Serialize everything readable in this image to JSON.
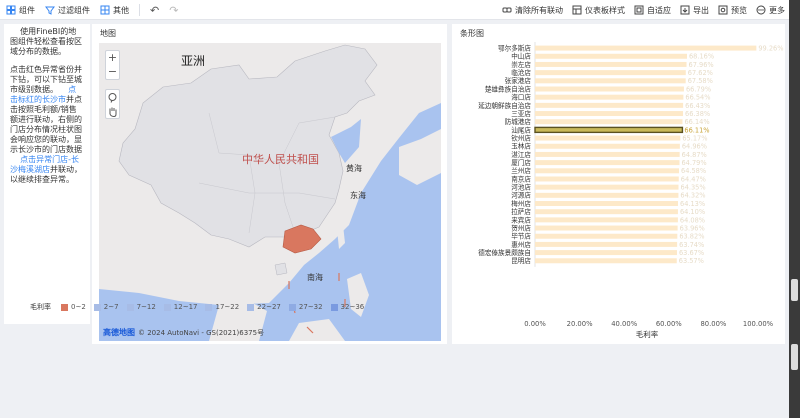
{
  "toolbar": {
    "left": [
      {
        "label": "组件",
        "icon": "component-icon"
      },
      {
        "label": "过滤组件",
        "icon": "filter-icon"
      },
      {
        "label": "其他",
        "icon": "grid-icon"
      }
    ],
    "right": [
      {
        "label": "清除所有联动",
        "icon": "link-clear-icon"
      },
      {
        "label": "仪表板样式",
        "icon": "style-icon"
      },
      {
        "label": "自适应",
        "icon": "adapt-icon"
      },
      {
        "label": "导出",
        "icon": "export-icon"
      },
      {
        "label": "预览",
        "icon": "preview-icon"
      },
      {
        "label": "更多",
        "icon": "more-icon"
      }
    ],
    "undo_glyph": "↶",
    "redo_glyph": "↷"
  },
  "text_panel": {
    "p1": "使用FineBI的地图组件轻松查看按区域分布的数据。",
    "p2_a": "点击红色异常省份并下钻，可以下钻至城市级别数据。",
    "p2_b": "点击标红的长沙市",
    "p2_c": "并点击按照毛利额/销售额进行联动，右侧的门店分布情况柱状图会响应您的联动，显示长沙市的门店数据",
    "p3_a": "点击异常门店-长沙梅溪湖店",
    "p3_b": "并联动，以继续排查异常。"
  },
  "map_panel": {
    "title": "地图",
    "labels": {
      "asia": "亚洲",
      "china": "中华人民共和国",
      "yellow_sea": "黄海",
      "east_sea": "东海",
      "south_sea": "南海"
    },
    "zoom_in": "+",
    "zoom_out": "−",
    "attribution": "© 2024 AutoNavi - GS(2021)6375号",
    "logo": "高德地图"
  },
  "legend": {
    "title": "毛利率",
    "items": [
      {
        "label": "0~2",
        "color": "#d9775f"
      },
      {
        "label": "2~7",
        "color": "#a7bce6"
      },
      {
        "label": "7~12",
        "color": "#a7bce6"
      },
      {
        "label": "12~17",
        "color": "#a7bce6"
      },
      {
        "label": "17~22",
        "color": "#a7bce6"
      },
      {
        "label": "22~27",
        "color": "#a7bce6"
      },
      {
        "label": "27~32",
        "color": "#8fabe3"
      },
      {
        "label": "32~36",
        "color": "#7a9ae0"
      }
    ]
  },
  "bar_panel": {
    "title": "条形图",
    "xlabel": "毛利率"
  },
  "chart_data": {
    "type": "bar",
    "orientation": "horizontal",
    "title": "条形图",
    "xlabel": "毛利率",
    "ylabel": "",
    "xlim": [
      0,
      100
    ],
    "xticks": [
      "0.00%",
      "20.00%",
      "40.00%",
      "60.00%",
      "80.00%",
      "100.00%"
    ],
    "categories": [
      "鄂尔多斯店",
      "中山店",
      "崇左店",
      "临沧店",
      "张家港店",
      "楚雄彝族自治店",
      "海口店",
      "延边朝鲜族自治店",
      "三亚店",
      "防城港店",
      "汕尾店",
      "钦州店",
      "玉林店",
      "湛江店",
      "厦门店",
      "兰州店",
      "南京店",
      "河池店",
      "河源店",
      "梅州店",
      "拉萨店",
      "来宾店",
      "贺州店",
      "毕节店",
      "惠州店",
      "德宏傣族景颇族自",
      "昆明店"
    ],
    "values": [
      99.26,
      68.16,
      67.96,
      67.62,
      67.58,
      66.79,
      66.54,
      66.43,
      66.38,
      66.14,
      66.11,
      65.17,
      64.96,
      64.87,
      64.79,
      64.58,
      64.47,
      64.35,
      64.32,
      64.13,
      64.1,
      64.08,
      63.96,
      63.82,
      63.74,
      63.67,
      63.57
    ],
    "value_labels": [
      "99.26%",
      "68.16%",
      "67.96%",
      "67.62%",
      "67.58%",
      "66.79%",
      "66.54%",
      "66.43%",
      "66.38%",
      "66.14%",
      "66.11%",
      "65.17%",
      "64.96%",
      "64.87%",
      "64.79%",
      "64.58%",
      "64.47%",
      "64.35%",
      "64.32%",
      "64.13%",
      "64.10%",
      "64.08%",
      "63.96%",
      "63.82%",
      "63.74%",
      "63.67%",
      "63.57%"
    ],
    "highlight_index": 10,
    "colors": {
      "bar": "#fde9c9",
      "highlight": "#c9b95a",
      "highlight_stroke": "#5a5120",
      "label": "#e7dcc8",
      "highlight_label": "#c9a43a"
    }
  }
}
